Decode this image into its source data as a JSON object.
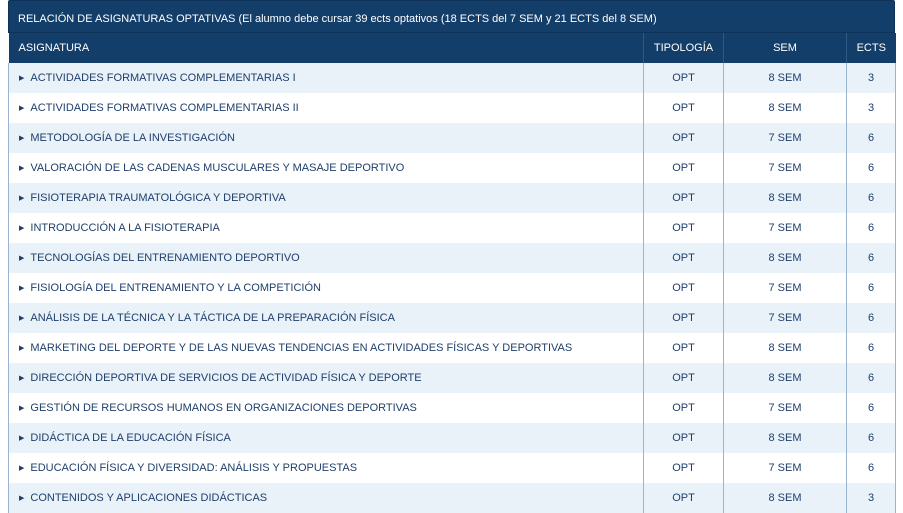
{
  "table": {
    "caption": "RELACIÓN DE ASIGNATURAS OPTATIVAS (El alumno debe cursar 39 ects optativos (18 ECTS del 7 SEM y 21 ECTS del 8 SEM)",
    "headers": {
      "asignatura": "ASIGNATURA",
      "tipologia": "TIPOLOGÍA",
      "sem": "SEM",
      "ects": "ECTS"
    },
    "rows": [
      {
        "name": "ACTIVIDADES FORMATIVAS COMPLEMENTARIAS I",
        "tipologia": "OPT",
        "sem": "8 SEM",
        "ects": "3"
      },
      {
        "name": "ACTIVIDADES FORMATIVAS COMPLEMENTARIAS II",
        "tipologia": "OPT",
        "sem": "8 SEM",
        "ects": "3"
      },
      {
        "name": "METODOLOGÍA DE LA INVESTIGACIÓN",
        "tipologia": "OPT",
        "sem": "7 SEM",
        "ects": "6"
      },
      {
        "name": "VALORACIÓN DE LAS CADENAS MUSCULARES Y MASAJE DEPORTIVO",
        "tipologia": "OPT",
        "sem": "7 SEM",
        "ects": "6"
      },
      {
        "name": "FISIOTERAPIA TRAUMATOLÓGICA Y DEPORTIVA",
        "tipologia": "OPT",
        "sem": "8 SEM",
        "ects": "6"
      },
      {
        "name": "INTRODUCCIÓN A LA FISIOTERAPIA",
        "tipologia": "OPT",
        "sem": "7 SEM",
        "ects": "6"
      },
      {
        "name": "TECNOLOGÍAS DEL ENTRENAMIENTO DEPORTIVO",
        "tipologia": "OPT",
        "sem": "8 SEM",
        "ects": "6"
      },
      {
        "name": "FISIOLOGÍA DEL ENTRENAMIENTO Y LA COMPETICIÓN",
        "tipologia": "OPT",
        "sem": "7 SEM",
        "ects": "6"
      },
      {
        "name": "ANÁLISIS DE LA TÉCNICA Y LA TÁCTICA DE LA PREPARACIÓN FÍSICA",
        "tipologia": "OPT",
        "sem": "7 SEM",
        "ects": "6"
      },
      {
        "name": "MARKETING DEL DEPORTE Y DE LAS NUEVAS TENDENCIAS EN ACTIVIDADES FÍSICAS Y DEPORTIVAS",
        "tipologia": "OPT",
        "sem": "8 SEM",
        "ects": "6"
      },
      {
        "name": "DIRECCIÓN DEPORTIVA DE SERVICIOS DE ACTIVIDAD FÍSICA Y DEPORTE",
        "tipologia": "OPT",
        "sem": "8 SEM",
        "ects": "6"
      },
      {
        "name": "GESTIÓN DE RECURSOS HUMANOS EN ORGANIZACIONES DEPORTIVAS",
        "tipologia": "OPT",
        "sem": "7 SEM",
        "ects": "6"
      },
      {
        "name": "DIDÁCTICA DE LA EDUCACIÓN FÍSICA",
        "tipologia": "OPT",
        "sem": "8 SEM",
        "ects": "6"
      },
      {
        "name": "EDUCACIÓN FÍSICA Y DIVERSIDAD: ANÁLISIS Y PROPUESTAS",
        "tipologia": "OPT",
        "sem": "7 SEM",
        "ects": "6"
      },
      {
        "name": "CONTENIDOS Y APLICACIONES DIDÁCTICAS",
        "tipologia": "OPT",
        "sem": "8 SEM",
        "ects": "3"
      }
    ]
  },
  "colors": {
    "header_bg": "#143e6a",
    "row_alt_bg": "#e9f1f9",
    "text": "#1f3f6b"
  },
  "icons": {
    "row_bullet": "triangle-right-icon"
  }
}
